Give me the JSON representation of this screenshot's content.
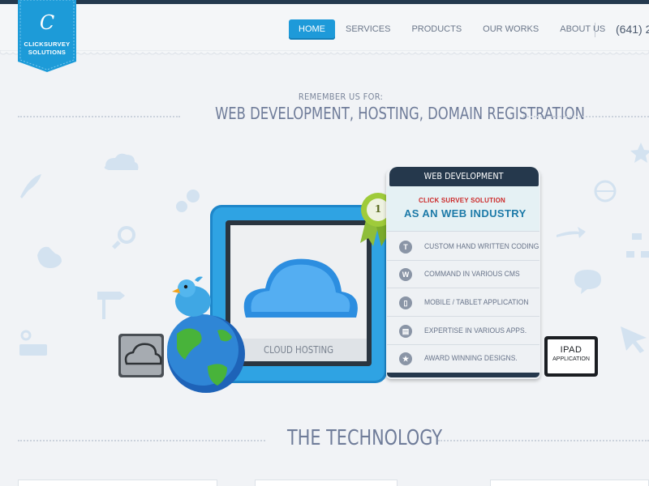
{
  "logo": {
    "letter": "C",
    "line1": "CLICKSURVEY",
    "line2": "SOLUTIONS"
  },
  "nav": {
    "items": [
      {
        "label": "HOME",
        "active": true
      },
      {
        "label": "SERVICES",
        "active": false
      },
      {
        "label": "PRODUCTS",
        "active": false
      },
      {
        "label": "OUR WORKS",
        "active": false
      },
      {
        "label": "ABOUT US",
        "active": false
      }
    ],
    "phone": "(641) 2"
  },
  "hero": {
    "kicker": "REMEMBER US FOR:",
    "title": "WEB DEVELOPMENT, HOSTING, DOMAIN REGISTRATION",
    "cloud_label": "CLOUD HOSTING",
    "ribbon_number": "1"
  },
  "panel": {
    "tab": "WEB DEVELOPMENT",
    "subtitle": "CLICK SURVEY SOLUTION",
    "title": "AS AN WEB INDUSTRY",
    "features": [
      {
        "icon": "text-icon",
        "glyph": "T",
        "label": "CUSTOM HAND WRITTEN CODING"
      },
      {
        "icon": "wordpress-icon",
        "glyph": "W",
        "label": "COMMAND IN VARIOUS CMS"
      },
      {
        "icon": "mobile-icon",
        "glyph": "▯",
        "label": "MOBILE / TABLET APPLICATION"
      },
      {
        "icon": "apps-icon",
        "glyph": "▤",
        "label": "EXPERTISE IN VARIOUS APPS."
      },
      {
        "icon": "award-icon",
        "glyph": "★",
        "label": "AWARD WINNING DESIGNS."
      }
    ]
  },
  "ipad": {
    "title": "IPAD",
    "subtitle": "APPLICATION"
  },
  "technology": {
    "title": "THE TECHNOLOGY"
  },
  "colors": {
    "accent": "#1e9ad9",
    "dark": "#243a4f",
    "heading": "#6f7c99",
    "panel_red": "#cc2a2a",
    "panel_blue": "#1c7aa8"
  }
}
